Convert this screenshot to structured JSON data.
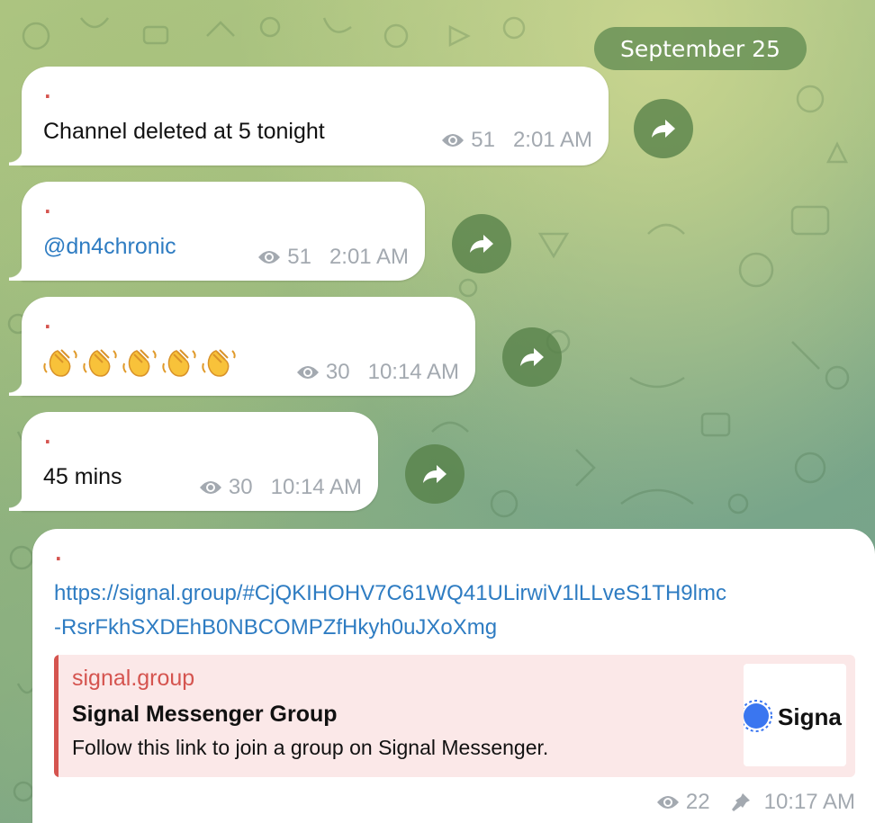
{
  "date_header": "September 25",
  "messages": [
    {
      "dot": ".",
      "text": "Channel deleted at 5 tonight",
      "views": "51",
      "time": "2:01 AM"
    },
    {
      "dot": ".",
      "text": "@dn4chronic",
      "views": "51",
      "time": "2:01 AM"
    },
    {
      "dot": ".",
      "emoji_count": 5,
      "emoji_name": "waving-hand-emoji",
      "views": "30",
      "time": "10:14 AM"
    },
    {
      "dot": ".",
      "text": "45 mins",
      "views": "30",
      "time": "10:14 AM"
    },
    {
      "dot": ".",
      "link_line1": "https://signal.group/#CjQKIHOHV7C61WQ41ULirwiV1lLLveS1TH9lmc",
      "link_line2": "-RsrFkhSXDEhB0NBCOMPZfHkyh0uJXoXmg",
      "preview": {
        "site": "signal.group",
        "title": "Signal Messenger Group",
        "description": "Follow this link to join a group on Signal Messenger.",
        "thumb_text": "Signa"
      },
      "views": "22",
      "time": "10:17 AM"
    }
  ],
  "icons": {
    "views": "eye-icon",
    "forward": "forward-arrow-icon",
    "pin": "pin-icon"
  },
  "colors": {
    "accent_link": "#2e7cc2",
    "dot_red": "#d5544f",
    "meta_gray": "#a3a9b0",
    "preview_bg": "#fbe8e8"
  }
}
